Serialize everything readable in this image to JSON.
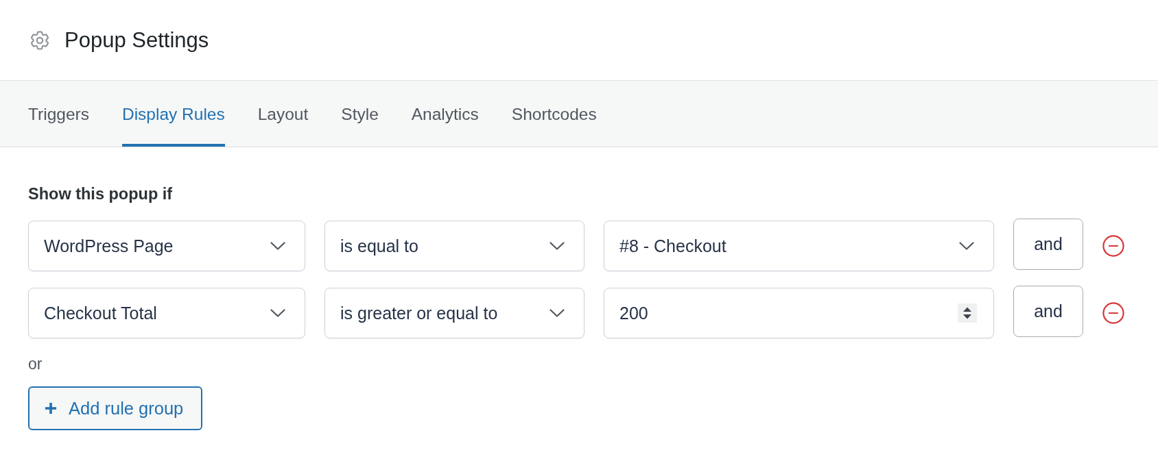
{
  "header": {
    "title": "Popup Settings"
  },
  "tabs": [
    {
      "label": "Triggers",
      "selected": false
    },
    {
      "label": "Display Rules",
      "selected": true
    },
    {
      "label": "Layout",
      "selected": false
    },
    {
      "label": "Style",
      "selected": false
    },
    {
      "label": "Analytics",
      "selected": false
    },
    {
      "label": "Shortcodes",
      "selected": false
    }
  ],
  "rules": {
    "heading": "Show this popup if",
    "rows": [
      {
        "fields": [
          {
            "kind": "select",
            "value": "WordPress Page"
          },
          {
            "kind": "select",
            "value": "is equal to"
          },
          {
            "kind": "select",
            "value": "#8 - Checkout"
          }
        ],
        "connector": "and"
      },
      {
        "fields": [
          {
            "kind": "select",
            "value": "Checkout Total"
          },
          {
            "kind": "select",
            "value": "is greater or equal to"
          },
          {
            "kind": "number",
            "value": "200"
          }
        ],
        "connector": "and"
      }
    ],
    "separator": "or",
    "add_button": {
      "label": "Add rule group"
    }
  }
}
